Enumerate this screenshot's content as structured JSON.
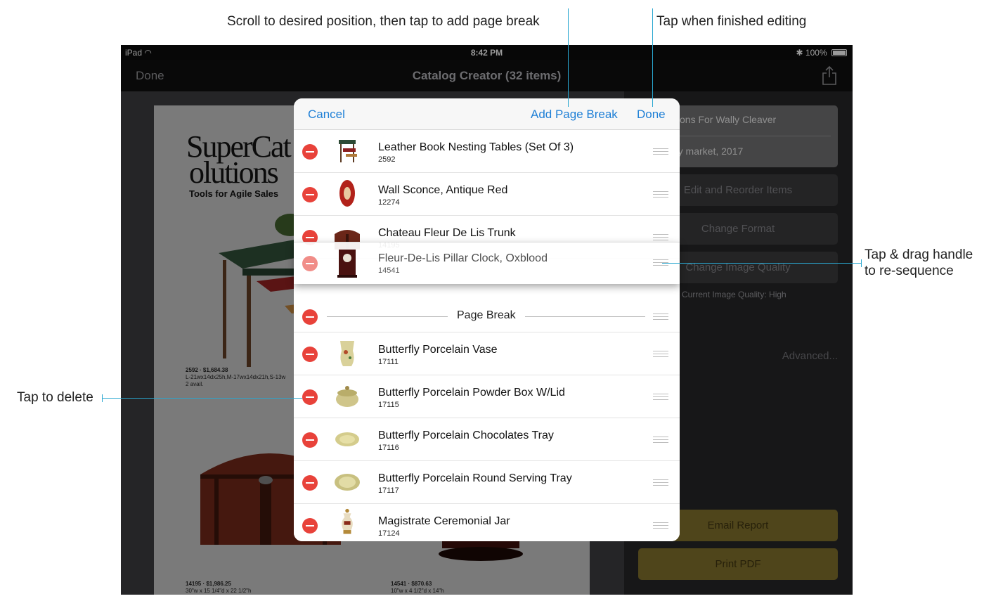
{
  "annotations": {
    "scroll_hint": "Scroll to desired position, then tap to add page break",
    "done_hint": "Tap when finished editing",
    "drag_hint_line1": "Tap & drag handle",
    "drag_hint_line2": "to re-sequence",
    "delete_hint": "Tap to delete"
  },
  "status_bar": {
    "device": "iPad",
    "time": "8:42 PM",
    "battery": "100%"
  },
  "nav": {
    "done_label": "Done",
    "title": "Catalog Creator (32 items)",
    "share_icon": "share-icon"
  },
  "preview": {
    "logo_line1": "SuperCat",
    "logo_line2": "olutions",
    "logo_tagline": "Tools for Agile Sales",
    "item1_caption": "2592 · $1,684.38",
    "item1_dims": "L-21wx14dx25h,M-17wx14dx21h,S-13w",
    "item1_avail": "2 avail.",
    "item2_caption": "14195 · $1,986.25",
    "item2_dims": "30\"w x 15 1/4\"d x 22 1/2\"h",
    "item3_caption": "14541 · $870.63",
    "item3_dims": "10\"w x 4 1/2\"d x 14\"h"
  },
  "settings": {
    "catalog_name": "tions For Wally Cleaver",
    "catalog_subtitle": "ry market, 2017",
    "edit_reorder": "Edit and Reorder Items",
    "change_format": "Change Format",
    "change_image_quality": "Change Image Quality",
    "image_quality_status": "Current Image Quality: High",
    "advanced": "Advanced...",
    "email_report": "Email Report",
    "print_pdf": "Print PDF"
  },
  "modal": {
    "cancel_label": "Cancel",
    "add_page_break_label": "Add Page Break",
    "done_label": "Done",
    "page_break_label": "Page Break",
    "items": [
      {
        "name": "Leather Book Nesting Tables (Set Of 3)",
        "sku": "2592"
      },
      {
        "name": "Wall Sconce, Antique Red",
        "sku": "12274"
      },
      {
        "name": "Chateau Fleur De Lis Trunk",
        "sku": "14195"
      },
      {
        "name": "Butterfly Porcelain Vase",
        "sku": "17111"
      },
      {
        "name": "Butterfly Porcelain Powder Box W/Lid",
        "sku": "17115"
      },
      {
        "name": "Butterfly Porcelain Chocolates Tray",
        "sku": "17116"
      },
      {
        "name": "Butterfly Porcelain Round Serving Tray",
        "sku": "17117"
      },
      {
        "name": "Magistrate Ceremonial Jar",
        "sku": "17124"
      }
    ],
    "dragging_item": {
      "name": "Fleur-De-Lis Pillar Clock, Oxblood",
      "sku": "14541"
    }
  },
  "colors": {
    "accent": "#1e7fd6",
    "delete": "#e8423a",
    "callout": "#2aa7d0",
    "gold_button": "#7a6a2a"
  }
}
